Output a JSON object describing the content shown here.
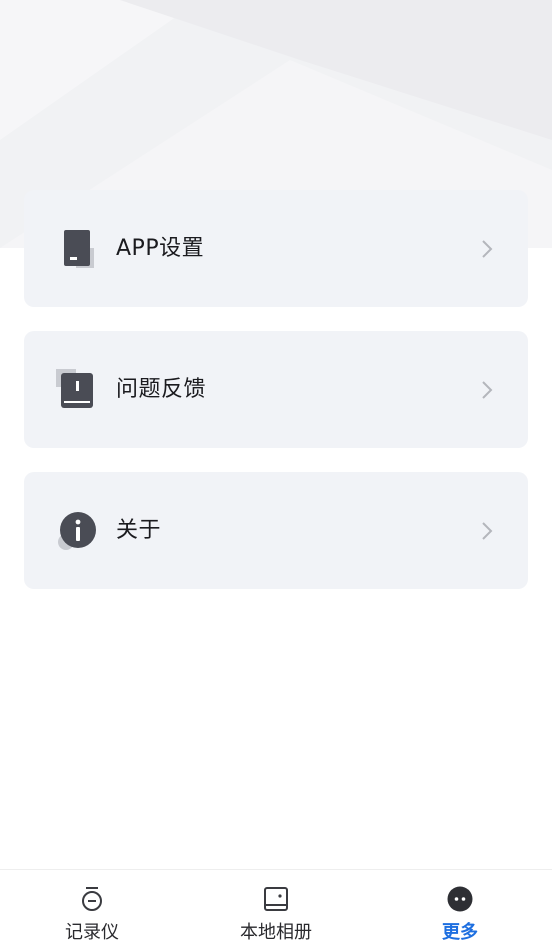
{
  "menu": {
    "items": [
      {
        "label": "APP设置",
        "icon": "app-settings-icon"
      },
      {
        "label": "问题反馈",
        "icon": "feedback-book-icon"
      },
      {
        "label": "关于",
        "icon": "info-icon"
      }
    ]
  },
  "tabbar": {
    "tabs": [
      {
        "label": "记录仪",
        "icon": "recorder-icon",
        "active": false
      },
      {
        "label": "本地相册",
        "icon": "album-icon",
        "active": false
      },
      {
        "label": "更多",
        "icon": "more-icon",
        "active": true
      }
    ]
  },
  "colors": {
    "accent": "#1e6fe0",
    "card_bg": "#f1f3f7",
    "icon_dark": "#4a4c55",
    "icon_light": "#c9cbd1",
    "chevron": "#b4b6bc"
  }
}
